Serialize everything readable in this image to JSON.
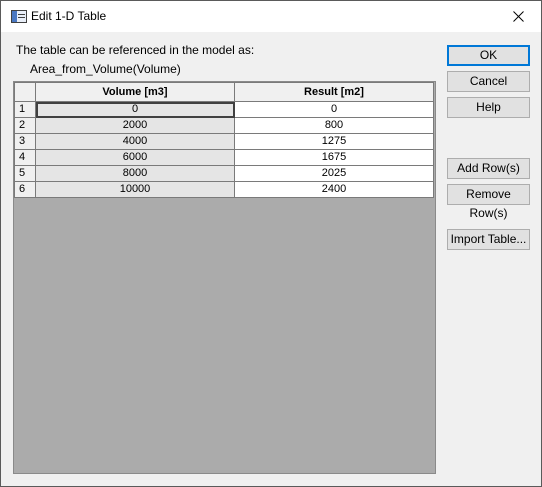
{
  "window": {
    "title": "Edit 1-D Table"
  },
  "reference": {
    "label": "The table can be referenced in the model as:",
    "name": "Area_from_Volume(Volume)"
  },
  "table": {
    "columns": [
      "Volume [m3]",
      "Result [m2]"
    ],
    "rows": [
      {
        "num": "1",
        "volume": "0",
        "result": "0"
      },
      {
        "num": "2",
        "volume": "2000",
        "result": "800"
      },
      {
        "num": "3",
        "volume": "4000",
        "result": "1275"
      },
      {
        "num": "4",
        "volume": "6000",
        "result": "1675"
      },
      {
        "num": "5",
        "volume": "8000",
        "result": "2025"
      },
      {
        "num": "6",
        "volume": "10000",
        "result": "2400"
      }
    ]
  },
  "buttons": {
    "ok": "OK",
    "cancel": "Cancel",
    "help": "Help",
    "add_rows": "Add Row(s)",
    "remove_rows": "Remove Row(s)",
    "import_table": "Import Table..."
  }
}
